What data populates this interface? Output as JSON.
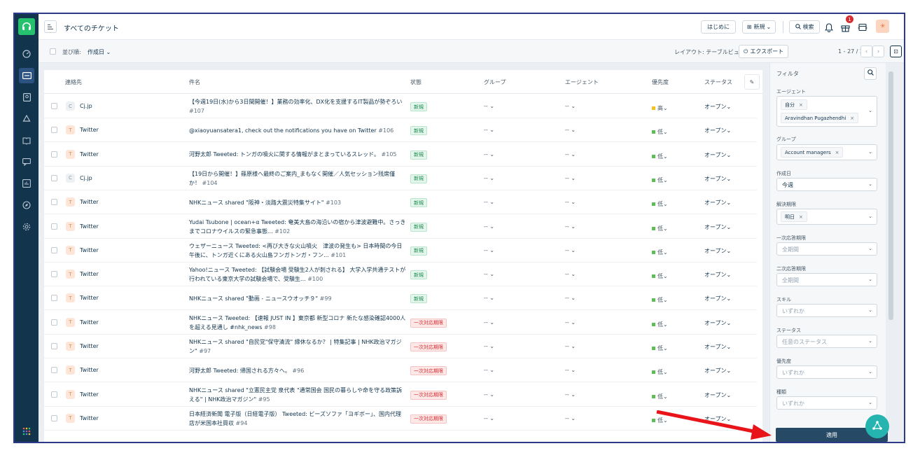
{
  "header": {
    "title": "すべてのチケット",
    "getting_started": "はじめに",
    "new_label": "新規",
    "search_label": "検索",
    "notification_count": "1",
    "avatar_initial": "☀"
  },
  "toolbar": {
    "sort_label": "並び順:",
    "sort_value": "作成日",
    "layout_label": "レイアウト: テーブルビュー",
    "export_label": "エクスポート",
    "page_info": "1 - 27 / 27"
  },
  "columns": {
    "contact": "連絡先",
    "subject": "件名",
    "state": "状態",
    "group": "グループ",
    "agent": "エージェント",
    "priority": "優先度",
    "status": "ステータス"
  },
  "rows": [
    {
      "icon": "C",
      "contact": "Cj.jp",
      "subject": "【今週19日(水)から3日間開催！】業務の効率化、DX化を支援するIT製品が勢ぞろい",
      "num": "#107",
      "tag": "新規",
      "tag_type": "new",
      "group": "-- ",
      "agent": "-- ",
      "priority": "高",
      "prio_color": "#f5c21d",
      "status": "オープン"
    },
    {
      "icon": "T",
      "contact": "Twitter",
      "subject": "@xiaoyuansatera1, check out the notifications you have on Twitter",
      "num": "#106",
      "tag": "新規",
      "tag_type": "new",
      "group": "-- ",
      "agent": "-- ",
      "priority": "低",
      "prio_color": "#5dbf53",
      "status": "オープン"
    },
    {
      "icon": "T",
      "contact": "Twitter",
      "subject": "河野太郎 Tweeted: トンガの噴火に関する情報がまとまっているスレッド。",
      "num": "#105",
      "tag": "新規",
      "tag_type": "new",
      "group": "-- ",
      "agent": "-- ",
      "priority": "低",
      "prio_color": "#5dbf53",
      "status": "オープン"
    },
    {
      "icon": "C",
      "contact": "Cj.jp",
      "subject": "【19日から開催！】篠原様へ最終のご案内_まもなく開催／人気セッション残席僅か！",
      "num": "#104",
      "tag": "新規",
      "tag_type": "new",
      "group": "-- ",
      "agent": "-- ",
      "priority": "低",
      "prio_color": "#5dbf53",
      "status": "オープン"
    },
    {
      "icon": "T",
      "contact": "Twitter",
      "subject": "NHKニュース shared \"阪神・淡路大震災特集サイト\"",
      "num": "#103",
      "tag": "新規",
      "tag_type": "new",
      "group": "-- ",
      "agent": "-- ",
      "priority": "低",
      "prio_color": "#5dbf53",
      "status": "オープン"
    },
    {
      "icon": "T",
      "contact": "Twitter",
      "subject": "Yudai Tsubone | ocean+α Tweeted: 奄美大島の海沿いの宿から津波避難中。さっきまでコロナウイルスの緊急事態...",
      "num": "#102",
      "tag": "新規",
      "tag_type": "new",
      "group": "-- ",
      "agent": "-- ",
      "priority": "低",
      "prio_color": "#5dbf53",
      "status": "オープン"
    },
    {
      "icon": "T",
      "contact": "Twitter",
      "subject": "ウェザーニュース Tweeted: <再び大きな火山噴火　津波の発生も> 日本時間の今日午後に、トンガ近くにある火山島フンガトンガ・フン...",
      "num": "#101",
      "tag": "新規",
      "tag_type": "new",
      "group": "-- ",
      "agent": "-- ",
      "priority": "低",
      "prio_color": "#5dbf53",
      "status": "オープン"
    },
    {
      "icon": "T",
      "contact": "Twitter",
      "subject": "Yahoo!ニュース Tweeted: 【試験会場 受験生2人が刺される】 大学入学共通テストが行われている東京大学の試験会場で、受験生...",
      "num": "#100",
      "tag": "新規",
      "tag_type": "new",
      "group": "-- ",
      "agent": "-- ",
      "priority": "低",
      "prio_color": "#5dbf53",
      "status": "オープン"
    },
    {
      "icon": "T",
      "contact": "Twitter",
      "subject": "NHKニュース shared \"動画 - ニュースウオッチ９\"",
      "num": "#99",
      "tag": "新規",
      "tag_type": "new",
      "group": "-- ",
      "agent": "-- ",
      "priority": "低",
      "prio_color": "#5dbf53",
      "status": "オープン"
    },
    {
      "icon": "T",
      "contact": "Twitter",
      "subject": "NHKニュース Tweeted: 【速報 JUST IN 】東京都 新型コロナ 新たな感染確認4000人を超える見通し #nhk_news",
      "num": "#98",
      "tag": "一次対応期限",
      "tag_type": "overdue",
      "group": "-- ",
      "agent": "-- ",
      "priority": "低",
      "prio_color": "#5dbf53",
      "status": "オープン"
    },
    {
      "icon": "T",
      "contact": "Twitter",
      "subject": "NHKニュース shared \"自民党\"保守清流\" 縁休なるか？ | 特集記事 | NHK政治マガジン\"",
      "num": "#97",
      "tag": "一次対応期限",
      "tag_type": "overdue",
      "group": "-- ",
      "agent": "-- ",
      "priority": "低",
      "prio_color": "#5dbf53",
      "status": "オープン"
    },
    {
      "icon": "T",
      "contact": "Twitter",
      "subject": "河野太郎 Tweeted: 帰国される方々へ。",
      "num": "#96",
      "tag": "一次対応期限",
      "tag_type": "overdue",
      "group": "-- ",
      "agent": "-- ",
      "priority": "低",
      "prio_color": "#5dbf53",
      "status": "オープン"
    },
    {
      "icon": "T",
      "contact": "Twitter",
      "subject": "NHKニュース shared \"立憲民主党 泉代表 \"通常国会 国民の暮らしや命を守る政策訴える\" | NHK政治マガジン\"",
      "num": "#95",
      "tag": "一次対応期限",
      "tag_type": "overdue",
      "group": "-- ",
      "agent": "-- ",
      "priority": "低",
      "prio_color": "#5dbf53",
      "status": "オープン"
    },
    {
      "icon": "T",
      "contact": "Twitter",
      "subject": "日本経済新聞 電子版（日経電子版） Tweeted: ビーズソファ「ヨギボー」、国内代理店が米国本社買収",
      "num": "#94",
      "tag": "一次対応期限",
      "tag_type": "overdue",
      "group": "-- ",
      "agent": "-- ",
      "priority": "低",
      "prio_color": "#5dbf53",
      "status": "オープン"
    }
  ],
  "filter": {
    "title": "フィルタ",
    "agent_label": "エージェント",
    "agent_chips": [
      "自分",
      "Aravindhan Pugazhendhi"
    ],
    "group_label": "グループ",
    "group_chips": [
      "Account managers"
    ],
    "created_label": "作成日",
    "created_value": "今週",
    "resolve_label": "解決期限",
    "resolve_chips": [
      "明日"
    ],
    "first_resp_label": "一次応答期限",
    "first_resp_ph": "全期間",
    "second_resp_label": "二次応答期限",
    "second_resp_ph": "全期間",
    "skill_label": "スキル",
    "skill_ph": "いずれか",
    "status_label": "ステータス",
    "status_ph": "任意のステータス",
    "priority_label": "優先度",
    "priority_ph": "いずれか",
    "type_label": "種類",
    "type_ph": "いずれか",
    "apply_label": "適用"
  }
}
